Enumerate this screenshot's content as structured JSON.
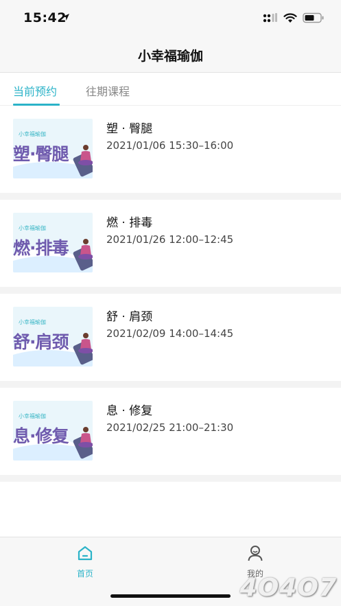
{
  "status_bar": {
    "time": "15:42"
  },
  "nav": {
    "title": "小幸福瑜伽"
  },
  "tabs": [
    {
      "label": "当前预约",
      "active": true
    },
    {
      "label": "往期课程",
      "active": false
    }
  ],
  "classes": [
    {
      "title": "塑 · 臀腿",
      "time": "2021/01/06 15:30–16:00",
      "thumb_brand": "小幸福瑜伽",
      "thumb_text": "塑·臀腿"
    },
    {
      "title": "燃 · 排毒",
      "time": "2021/01/26 12:00–12:45",
      "thumb_brand": "小幸福瑜伽",
      "thumb_text": "燃·排毒"
    },
    {
      "title": "舒 · 肩颈",
      "time": "2021/02/09 14:00–14:45",
      "thumb_brand": "小幸福瑜伽",
      "thumb_text": "舒·肩颈"
    },
    {
      "title": "息 · 修复",
      "time": "2021/02/25 21:00–21:30",
      "thumb_brand": "小幸福瑜伽",
      "thumb_text": "息·修复"
    }
  ],
  "bottom_nav": [
    {
      "label": "首页",
      "icon": "home-icon",
      "active": true
    },
    {
      "label": "我的",
      "icon": "profile-icon",
      "active": false
    }
  ],
  "watermark": "4O4O7",
  "colors": {
    "accent": "#2bb3c8",
    "thumb_text": "#6f5bae",
    "separator": "#f3f3f3"
  }
}
